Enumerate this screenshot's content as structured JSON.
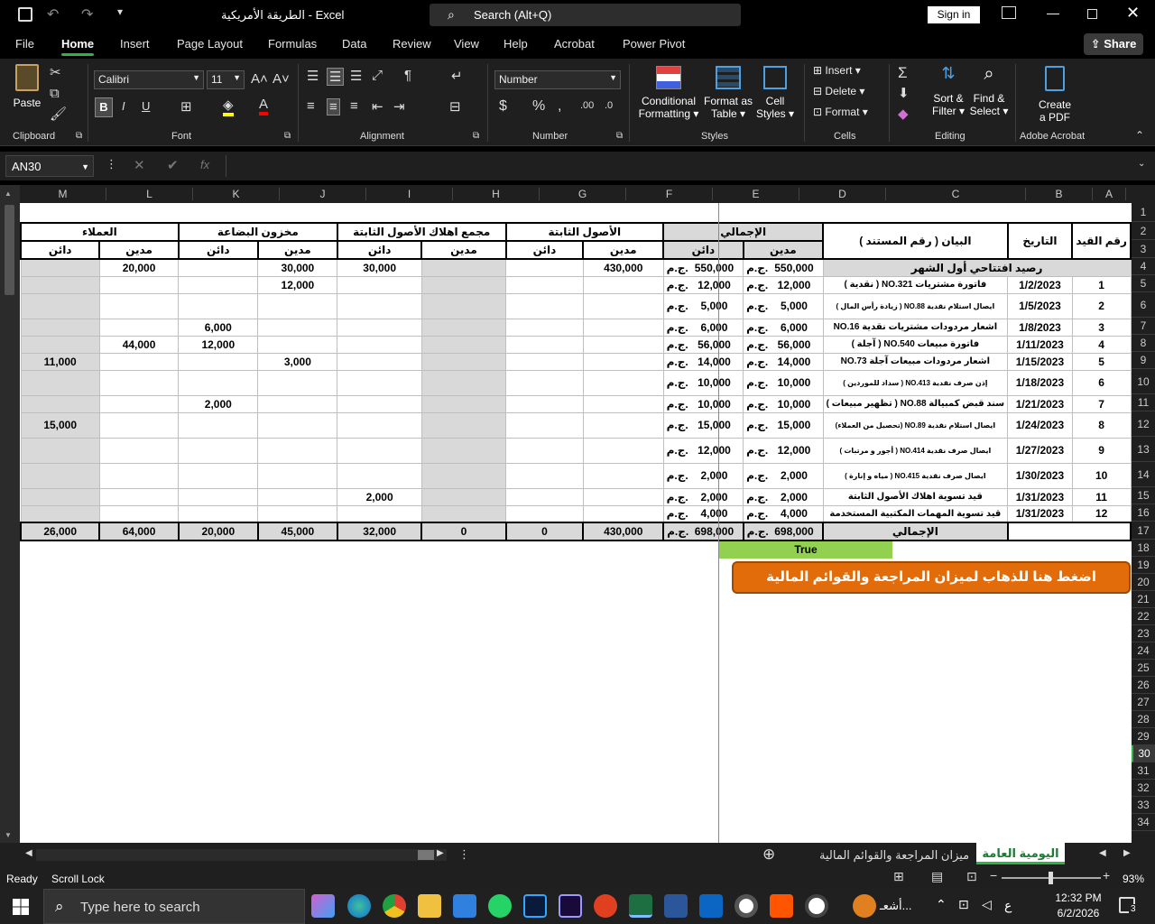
{
  "titlebar": {
    "doc_name": "الطريقة الأمريكية",
    "separator": "-",
    "app": "Excel",
    "search": "Search (Alt+Q)",
    "sign_in": "Sign in"
  },
  "menu": {
    "items": [
      "File",
      "Home",
      "Insert",
      "Page Layout",
      "Formulas",
      "Data",
      "Review",
      "View",
      "Help",
      "Acrobat",
      "Power Pivot"
    ],
    "active": "Home",
    "share": "Share"
  },
  "ribbon": {
    "clipboard": {
      "paste": "Paste",
      "label": "Clipboard"
    },
    "font": {
      "name": "Calibri",
      "size": "11",
      "label": "Font",
      "bold": "B",
      "italic": "I",
      "underline": "U"
    },
    "alignment": {
      "label": "Alignment"
    },
    "number": {
      "format": "Number",
      "label": "Number",
      "currency": "$",
      "percent": "%",
      "comma": ","
    },
    "styles": {
      "cond": "Conditional",
      "cond2": "Formatting",
      "fmt": "Format as",
      "fmt2": "Table",
      "cell": "Cell",
      "cell2": "Styles",
      "label": "Styles"
    },
    "cells": {
      "insert": "Insert",
      "delete": "Delete",
      "format": "Format",
      "label": "Cells"
    },
    "editing": {
      "sort": "Sort &",
      "sort2": "Filter",
      "find": "Find &",
      "find2": "Select",
      "label": "Editing"
    },
    "acrobat": {
      "create": "Create",
      "create2": "a PDF",
      "label": "Adobe Acrobat"
    }
  },
  "formula_bar": {
    "name_box": "AN30",
    "fx": "fx",
    "content": ""
  },
  "columns": [
    {
      "id": "M",
      "w": 96
    },
    {
      "id": "L",
      "w": 96
    },
    {
      "id": "K",
      "w": 96
    },
    {
      "id": "J",
      "w": 96
    },
    {
      "id": "I",
      "w": 96
    },
    {
      "id": "H",
      "w": 96
    },
    {
      "id": "G",
      "w": 96
    },
    {
      "id": "F",
      "w": 96
    },
    {
      "id": "E",
      "w": 96
    },
    {
      "id": "D",
      "w": 96
    },
    {
      "id": "C",
      "w": 155
    },
    {
      "id": "B",
      "w": 74
    },
    {
      "id": "A",
      "w": 37
    }
  ],
  "rows": [
    "1",
    "2",
    "3",
    "4",
    "5",
    "6",
    "7",
    "8",
    "9",
    "10",
    "11",
    "12",
    "13",
    "14",
    "15",
    "16",
    "17",
    "18",
    "19",
    "20",
    "21",
    "22",
    "23",
    "24",
    "25",
    "26",
    "27",
    "28",
    "29",
    "30",
    "31",
    "32",
    "33",
    "34"
  ],
  "sheet": {
    "group_headers": {
      "total": "الإجمالي",
      "fixed_assets": "الأصول الثابتة",
      "depr": "مجمع اهلاك الأصول الثابتة",
      "inventory": "مخزون البضاعة",
      "customers": "العملاء",
      "desc": "البيان ( رقم المستند )",
      "date": "التاريخ",
      "entry_no": "رقم القيد"
    },
    "debit": "مدين",
    "credit": "دائن",
    "currency": "ج.م.",
    "opening_label": "رصيد افتتاحي أول الشهر",
    "opening": {
      "E": "550,000",
      "D": "550,000",
      "F": "430,000",
      "I": "30,000",
      "J": "30,000",
      "L": "20,000"
    },
    "entries": [
      {
        "no": "1",
        "date": "1/2/2023",
        "desc": "فاتورة مشتريات NO.321 ( نقدية )",
        "E": "12,000",
        "D": "12,000",
        "J": "12,000",
        "h": 19
      },
      {
        "no": "2",
        "date": "1/5/2023",
        "desc": "ايصال استلام نقدية NO.88 ( زيادة رأس المال )",
        "E": "5,000",
        "D": "5,000",
        "h": 28
      },
      {
        "no": "3",
        "date": "1/8/2023",
        "desc": "اشعار مردودات مشتريات نقدية NO.16",
        "E": "6,000",
        "D": "6,000",
        "K": "6,000",
        "h": 19
      },
      {
        "no": "4",
        "date": "1/11/2023",
        "desc": "فاتورة مبيعات NO.540 ( آجلة )",
        "E": "56,000",
        "D": "56,000",
        "K": "12,000",
        "L": "44,000",
        "h": 19
      },
      {
        "no": "5",
        "date": "1/15/2023",
        "desc": "اشعار مردودات مبيعات آجلة NO.73",
        "E": "14,000",
        "D": "14,000",
        "J": "3,000",
        "M": "11,000",
        "h": 19
      },
      {
        "no": "6",
        "date": "1/18/2023",
        "desc": "إذن صرف نقدية NO.413 ( سداد للموردين )",
        "E": "10,000",
        "D": "10,000",
        "h": 28
      },
      {
        "no": "7",
        "date": "1/21/2023",
        "desc": "سند قبض كمبيالة NO.88 ( تظهير مبيعات )",
        "E": "10,000",
        "D": "10,000",
        "K": "2,000",
        "h": 19
      },
      {
        "no": "8",
        "date": "1/24/2023",
        "desc": "ايصال استلام نقدية NO.89 (تحصيل من العملاء)",
        "E": "15,000",
        "D": "15,000",
        "M": "15,000",
        "h": 28
      },
      {
        "no": "9",
        "date": "1/27/2023",
        "desc": "ايصال صرف نقدية NO.414 ( أجور و مرتبات )",
        "E": "12,000",
        "D": "12,000",
        "h": 28
      },
      {
        "no": "10",
        "date": "1/30/2023",
        "desc": "ايصال صرف نقدية NO.415 ( مياه و إنارة )",
        "E": "2,000",
        "D": "2,000",
        "h": 28
      },
      {
        "no": "11",
        "date": "1/31/2023",
        "desc": "قيد تسوية اهلاك الأصول الثابتة",
        "E": "2,000",
        "D": "2,000",
        "I": "2,000",
        "h": 19
      },
      {
        "no": "12",
        "date": "1/31/2023",
        "desc": "قيد تسوية المهمات المكتبية المستخدمة",
        "E": "4,000",
        "D": "4,000",
        "h": 19
      }
    ],
    "totals_label": "الإجمالي",
    "totals": {
      "M": "26,000",
      "L": "64,000",
      "K": "20,000",
      "J": "45,000",
      "I": "32,000",
      "H": "0",
      "G": "0",
      "F": "430,000",
      "E": "698,000",
      "D": "698,000"
    },
    "check": "True",
    "nav_button": "اضغط هنا للذهاب لميزان المراجعة والقوائم المالية"
  },
  "sheet_tabs": {
    "active": "اليومية العامة",
    "other": "ميزان المراجعة والقوائم المالية"
  },
  "status": {
    "ready": "Ready",
    "scroll": "Scroll Lock",
    "zoom": "93%"
  },
  "taskbar": {
    "search": "Type here to search",
    "time": "12:32 PM",
    "date": "6/2/2026",
    "notif": "3",
    "lang": "ع",
    "news": "أشعـ..."
  },
  "colors": {
    "accent_green": "#2fb344",
    "check_green": "#92d050",
    "button_orange": "#e36c0a",
    "header_gray": "#d9d9d9"
  }
}
